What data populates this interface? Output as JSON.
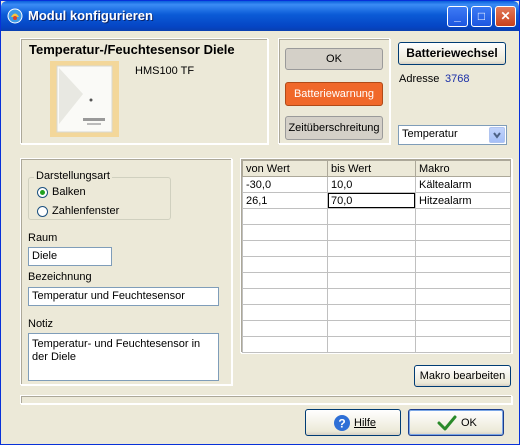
{
  "window": {
    "title": "Modul konfigurieren",
    "min_label": "_",
    "max_label": "□",
    "close_label": "✕"
  },
  "device": {
    "name": "Temperatur-/Feuchtesensor Diele",
    "model": "HMS100 TF"
  },
  "buttons": {
    "ok_top": "OK",
    "battery_warning": "Batteriewarnung",
    "timeout": "Zeitüberschreitung",
    "battery_change": "Batteriewechsel",
    "macro_edit": "Makro bearbeiten",
    "help": "Hilfe",
    "ok_bottom": "OK"
  },
  "address": {
    "label": "Adresse",
    "value": "3768"
  },
  "sensor_select": {
    "value": "Temperatur"
  },
  "display_mode": {
    "legend": "Darstellungsart",
    "options": [
      "Balken",
      "Zahlenfenster"
    ],
    "selected": "Balken"
  },
  "room": {
    "label": "Raum",
    "value": "Diele"
  },
  "designation": {
    "label": "Bezeichnung",
    "value": "Temperatur und Feuchtesensor"
  },
  "note": {
    "label": "Notiz",
    "value": "Temperatur- und Feuchtesensor in der Diele"
  },
  "macro_table": {
    "columns": [
      "von Wert",
      "bis Wert",
      "Makro"
    ],
    "rows": [
      [
        "-30,0",
        "10,0",
        "Kältealarm"
      ],
      [
        "26,1",
        "70,0",
        "Hitzealarm"
      ]
    ]
  },
  "colors": {
    "title_bar": "#0b5bd7",
    "battery_warning_bg": "#f0682a",
    "address_value": "#1a2fa8"
  },
  "icons": {
    "app": "app-icon",
    "help": "help-question-icon",
    "ok": "checkmark-icon",
    "dropdown": "chevron-down-icon"
  }
}
